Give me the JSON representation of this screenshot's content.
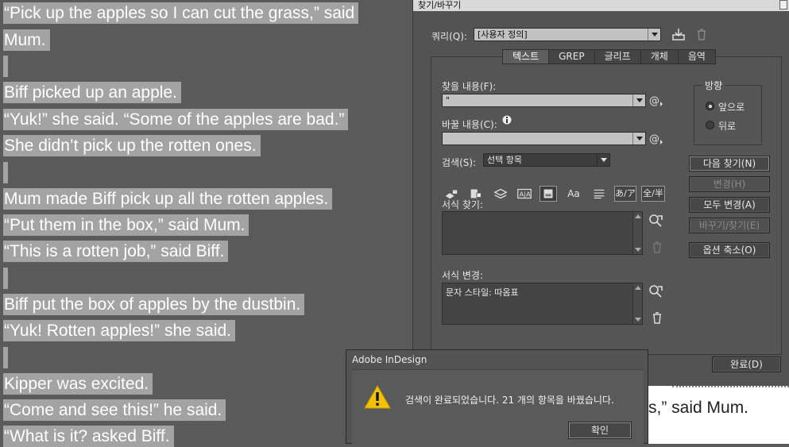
{
  "document": {
    "lines": [
      {
        "text": "“Pick up the apples so I can cut the grass,” said"
      },
      {
        "text": "Mum."
      },
      {
        "text": ""
      },
      {
        "text": "Biff picked up an apple."
      },
      {
        "text": "“Yuk!” she said. “Some of the apples are bad.”"
      },
      {
        "text": "She didn’t pick up the rotten ones."
      },
      {
        "text": ""
      },
      {
        "text": "Mum made Biff pick up all the rotten apples."
      },
      {
        "text": "“Put them in the box,” said Mum."
      },
      {
        "text": "“This is a rotten job,” said Biff."
      },
      {
        "text": ""
      },
      {
        "text": "Biff put the box of apples by the dustbin."
      },
      {
        "text": "“Yuk! Rotten apples!” she said."
      },
      {
        "text": ""
      },
      {
        "text": "Kipper was excited."
      },
      {
        "text": "“Come and see this!” he said."
      },
      {
        "text": "“What is it? asked Biff."
      }
    ],
    "right_fragment": "s,” said Mum."
  },
  "panel": {
    "title": "찾기/바꾸기",
    "query_label": "쿼리(Q):",
    "query_value": "[사용자 정의]",
    "tabs": [
      {
        "label": "텍스트",
        "active": true
      },
      {
        "label": "GREP",
        "active": false
      },
      {
        "label": "글리프",
        "active": false
      },
      {
        "label": "개체",
        "active": false
      },
      {
        "label": "음역",
        "active": false
      }
    ],
    "find_label": "찾을 내용(F):",
    "find_value": "\"",
    "change_label": "바꿀 내용(C):",
    "change_value": "",
    "search_label": "검색(S):",
    "search_value": "선택 항목",
    "direction": {
      "legend": "방향",
      "forward": "앞으로",
      "backward": "뒤로",
      "selected": "forward"
    },
    "find_format_label": "서식 찾기:",
    "find_format_value": "",
    "change_format_label": "서식 변경:",
    "change_format_value": "문자 스타일: 따옴표",
    "buttons": {
      "find_next": "다음 찾기(N)",
      "change": "변경(H)",
      "change_all": "모두 변경(A)",
      "change_find": "바꾸기/찾기(E)",
      "fewer_options": "옵션 축소(O)",
      "done": "완료(D)"
    },
    "option_icons": {
      "case": "Aa",
      "kana": "あ/ア",
      "width": "全/半"
    }
  },
  "alert": {
    "title": "Adobe InDesign",
    "message": "검색이 완료되었습니다. 21 개의 항목을 바꿨습니다.",
    "ok": "확인"
  },
  "colors": {
    "doc_background": "#5a5a5a",
    "text_highlight": "#a3a3a3",
    "panel_background": "#535353",
    "warning_yellow": "#f2c200"
  }
}
